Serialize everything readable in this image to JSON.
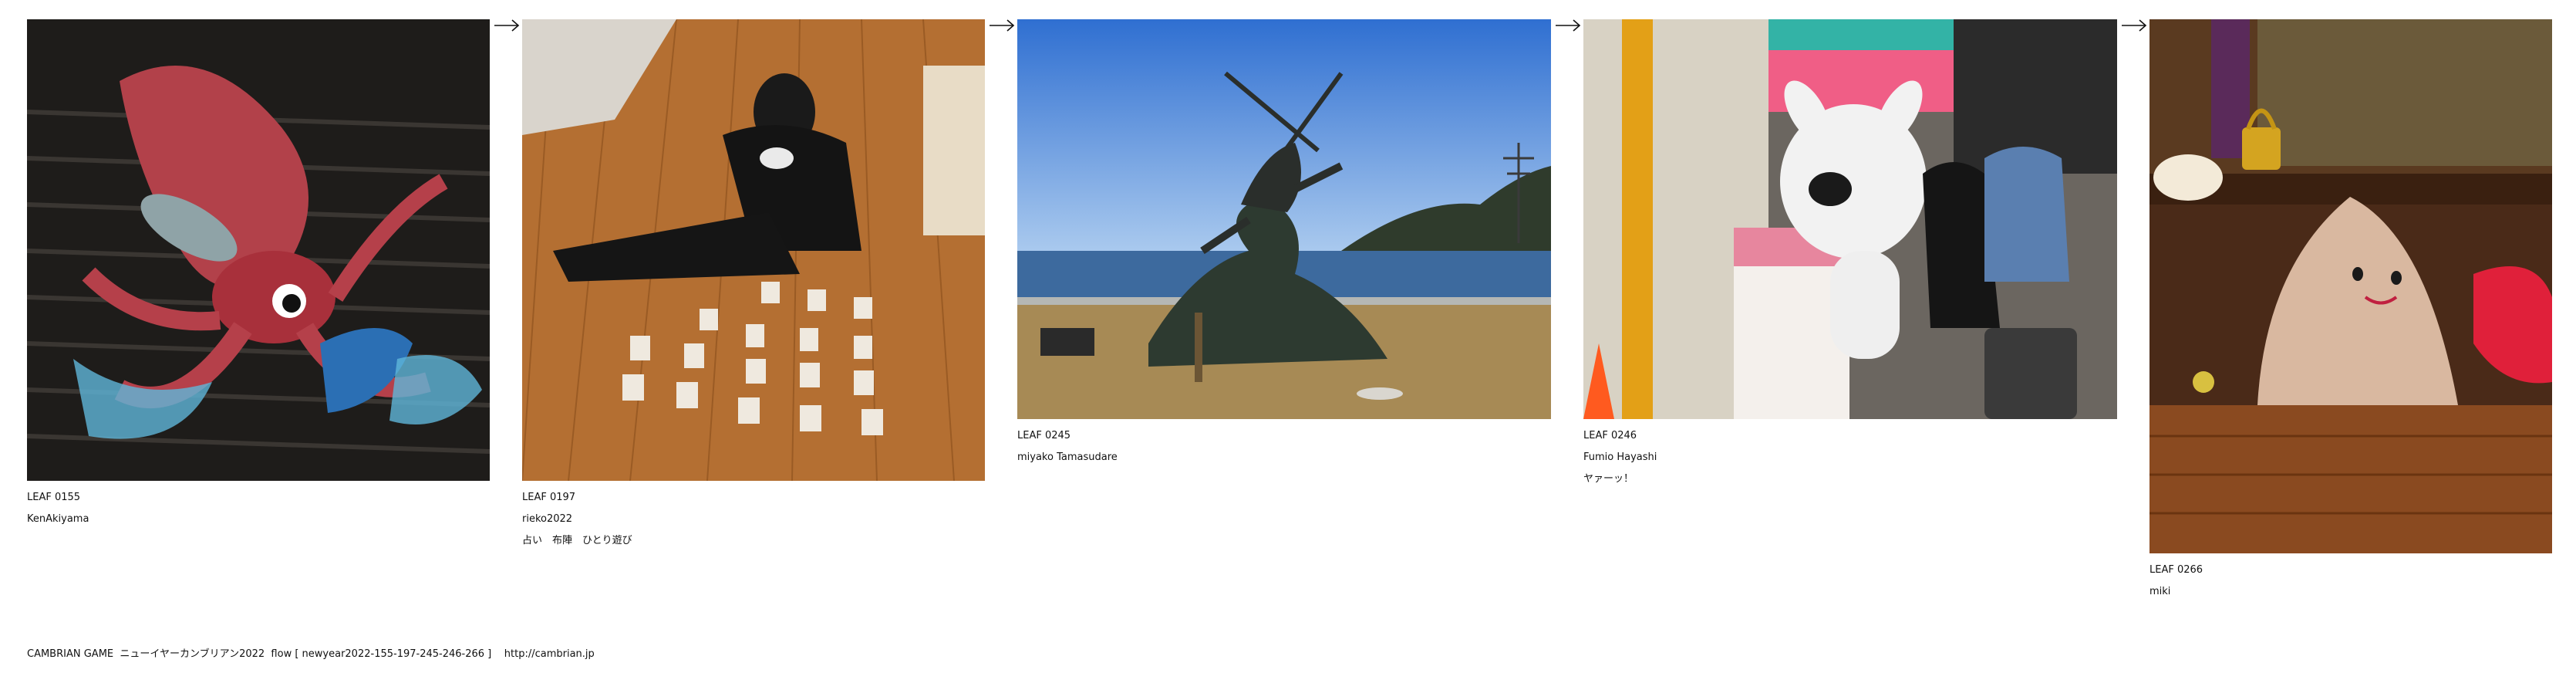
{
  "leaves": [
    {
      "id": "LEAF 0155",
      "author": "KenAkiyama",
      "comment": "",
      "image_alt": "Giant squid sculpture holding a fish"
    },
    {
      "id": "LEAF 0197",
      "author": "rieko2022",
      "comment": "占い　布陣　ひとり遊び",
      "image_alt": "Person sitting on wooden floor laying out paper cards"
    },
    {
      "id": "LEAF 0245",
      "author": "miyako Tamasudare",
      "comment": "",
      "image_alt": "Bronze warrior statue on a wave by the sea"
    },
    {
      "id": "LEAF 0246",
      "author": "Fumio Hayashi",
      "comment": "ヤァーッ！",
      "image_alt": "White rabbit mascot statue at a shop front"
    },
    {
      "id": "LEAF 0266",
      "author": "miki",
      "comment": "",
      "image_alt": "Felt plush mountain figure with a padlock"
    }
  ],
  "arrow_glyph": "→",
  "footer": {
    "text": "CAMBRIAN GAME  ニューイヤーカンブリアン2022  flow [ newyear2022-155-197-245-246-266 ]",
    "url": "http://cambrian.jp"
  }
}
